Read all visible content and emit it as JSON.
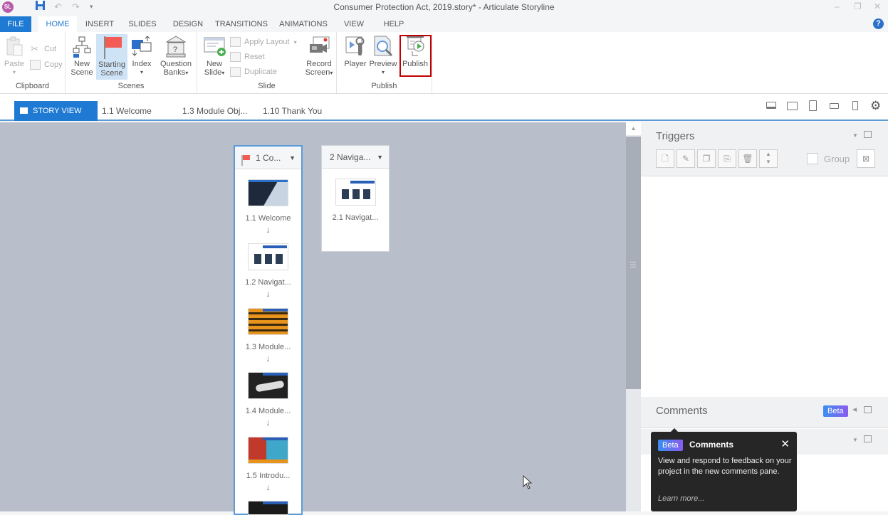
{
  "titlebar": {
    "app_logo": "SL",
    "title": "Consumer Protection Act, 2019.story* - Articulate Storyline",
    "quick_access": [
      "save-icon",
      "undo-icon",
      "redo-icon",
      "customize-icon"
    ],
    "window_controls": {
      "minimize": "–",
      "restore": "❐",
      "close": "✕"
    }
  },
  "ribbon_tabs": [
    "FILE",
    "HOME",
    "INSERT",
    "SLIDES",
    "DESIGN",
    "TRANSITIONS",
    "ANIMATIONS",
    "VIEW",
    "HELP"
  ],
  "active_tab": "HOME",
  "help": "?",
  "ribbon": {
    "clipboard": {
      "label": "Clipboard",
      "paste": "Paste",
      "cut": "Cut",
      "copy": "Copy"
    },
    "scenes": {
      "label": "Scenes",
      "new_scene_1": "New",
      "new_scene_2": "Scene",
      "starting_scene_1": "Starting",
      "starting_scene_2": "Scene",
      "index": "Index",
      "question_banks_1": "Question",
      "question_banks_2": "Banks"
    },
    "slide": {
      "label": "Slide",
      "new_slide_1": "New",
      "new_slide_2": "Slide",
      "apply_layout": "Apply Layout",
      "reset": "Reset",
      "duplicate": "Duplicate",
      "record_screen_1": "Record",
      "record_screen_2": "Screen"
    },
    "publish": {
      "label": "Publish",
      "player": "Player",
      "preview": "Preview",
      "publish": "Publish"
    }
  },
  "view_tabs": {
    "story_view": "STORY VIEW",
    "open_slides": [
      "1.1 Welcome",
      "1.3 Module Obj...",
      "1.10 Thank You"
    ]
  },
  "device_icons": [
    "desktop-icon",
    "tablet-landscape-icon",
    "tablet-portrait-icon",
    "phone-landscape-icon",
    "phone-portrait-icon",
    "settings-icon"
  ],
  "scenes": [
    {
      "title": "1 Co...",
      "starting": true,
      "slides": [
        "1.1 Welcome",
        "1.2 Navigat...",
        "1.3 Module...",
        "1.4 Module...",
        "1.5 Introdu..."
      ]
    },
    {
      "title": "2  Naviga...",
      "starting": false,
      "slides": [
        "2.1 Navigat..."
      ]
    }
  ],
  "triggers": {
    "title": "Triggers",
    "group_label": "Group"
  },
  "comments": {
    "title": "Comments",
    "beta": "Beta"
  },
  "tooltip": {
    "badge": "Beta",
    "title": "Comments",
    "body": "View and respond to feedback on your project in the new comments pane.",
    "link": "Learn more...",
    "close": "✕"
  },
  "colors": {
    "accent": "#1f7ad3",
    "highlight": "#c00000",
    "canvas": "#b9bfca",
    "flag": "#f25c54"
  }
}
